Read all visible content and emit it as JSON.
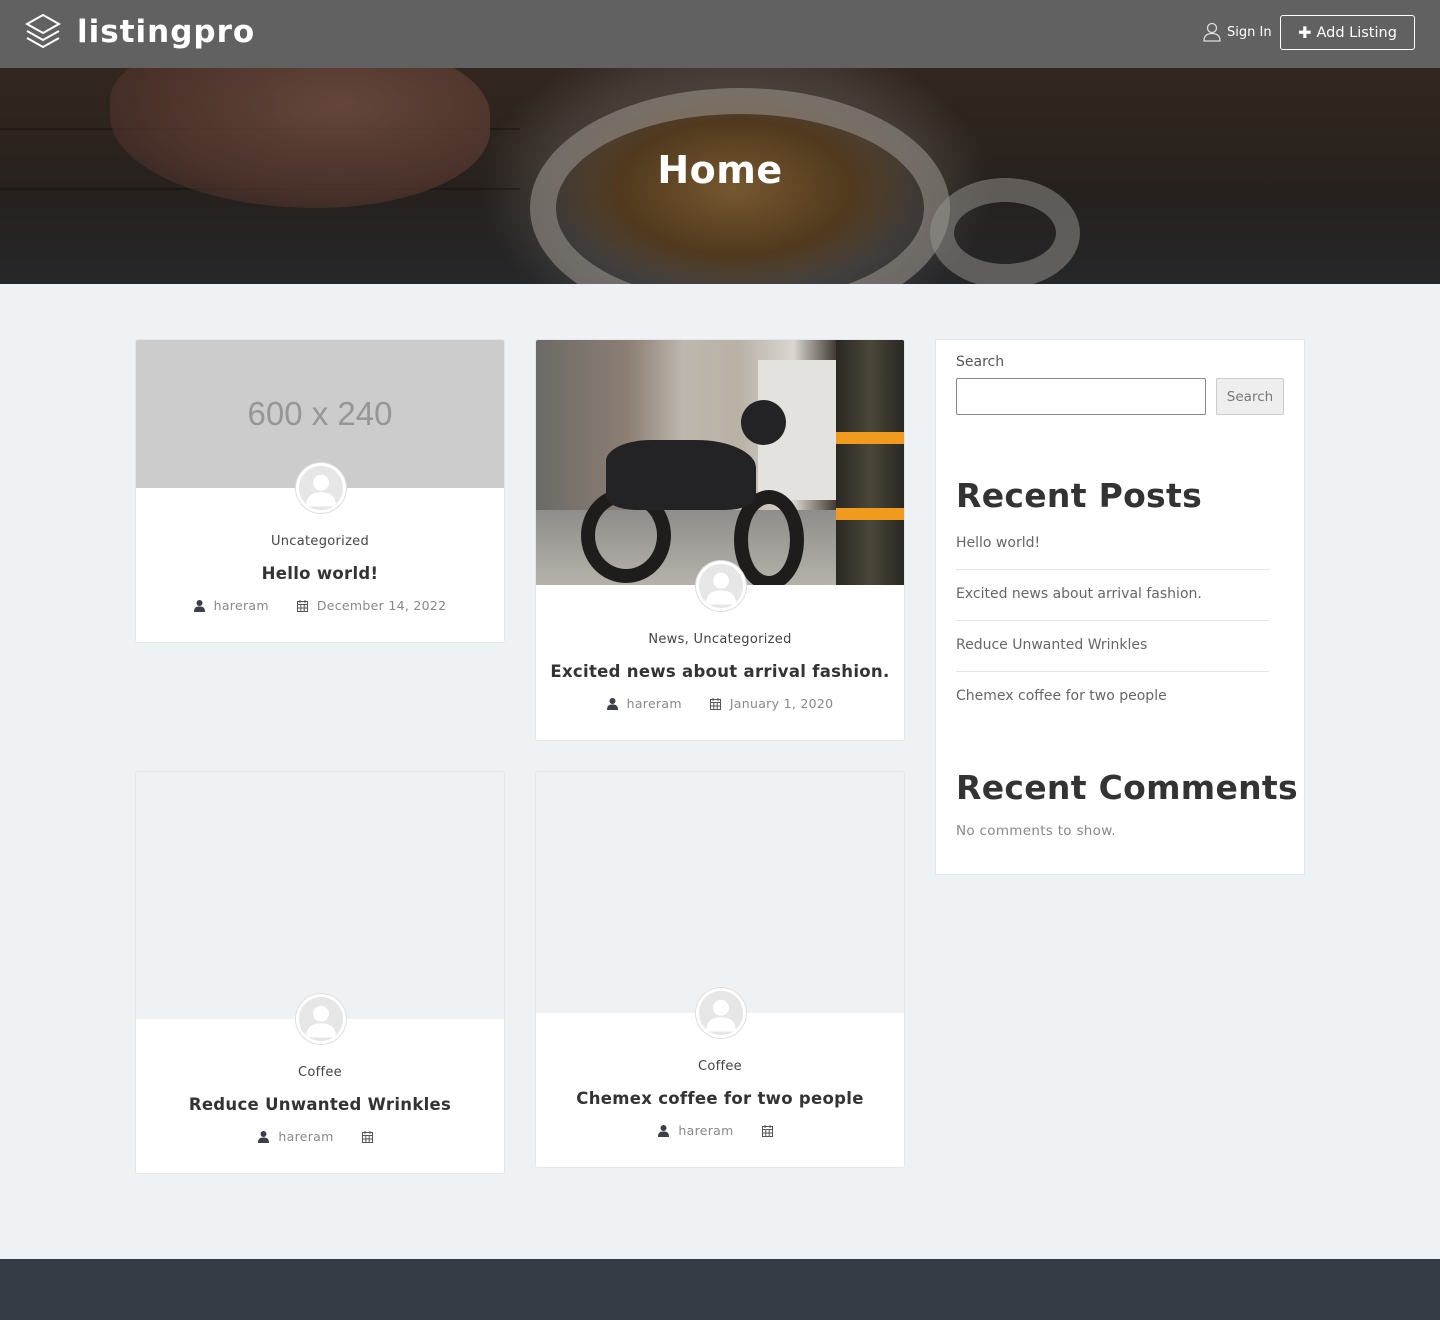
{
  "header": {
    "brand": "listingpro",
    "signin_label": "Sign In",
    "add_listing_label": "Add Listing"
  },
  "hero": {
    "title": "Home"
  },
  "posts": [
    {
      "image_text": "600 x 240",
      "category": "Uncategorized",
      "title": "Hello world!",
      "author": "hareram",
      "date": "December 14, 2022"
    },
    {
      "image_text": "",
      "category": "News, Uncategorized",
      "title": "Excited news about arrival fashion.",
      "author": "hareram",
      "date": "January 1, 2020"
    },
    {
      "image_text": "",
      "category": "Coffee",
      "title": "Reduce Unwanted Wrinkles",
      "author": "hareram",
      "date": ""
    },
    {
      "image_text": "",
      "category": "Coffee",
      "title": "Chemex coffee for two people",
      "author": "hareram",
      "date": ""
    }
  ],
  "sidebar": {
    "search_label": "Search",
    "search_value": "",
    "search_button": "Search",
    "recent_posts_heading": "Recent Posts",
    "recent_posts": [
      "Hello world!",
      "Excited news about arrival fashion.",
      "Reduce Unwanted Wrinkles",
      "Chemex coffee for two people"
    ],
    "recent_comments_heading": "Recent Comments",
    "no_comments_text": "No comments to show."
  },
  "colors": {
    "header_bg": "#616161",
    "page_bg": "#eff2f5",
    "footer_bg": "#363c45",
    "text_dark": "#333333"
  }
}
